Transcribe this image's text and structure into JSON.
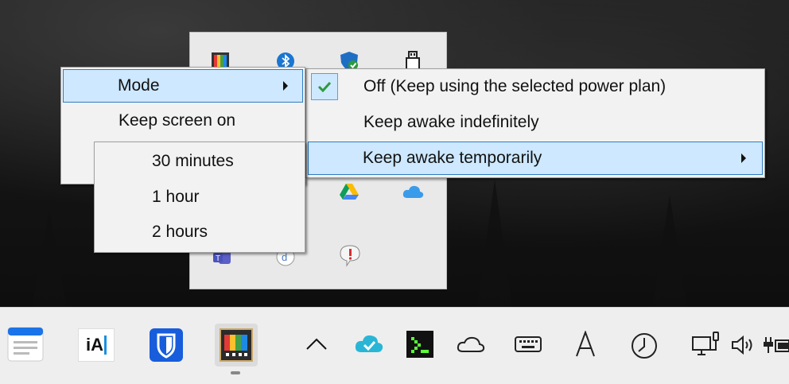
{
  "mode_menu": {
    "items": [
      {
        "label": "Mode"
      },
      {
        "label": "Keep screen on"
      }
    ]
  },
  "mode_submenu": {
    "items": [
      {
        "label": "Off (Keep using the selected power plan)",
        "checked": true
      },
      {
        "label": "Keep awake indefinitely"
      },
      {
        "label": "Keep awake temporarily"
      }
    ]
  },
  "temporary_submenu": {
    "items": [
      {
        "label": "30 minutes"
      },
      {
        "label": "1 hour"
      },
      {
        "label": "2 hours"
      }
    ]
  },
  "tray_flyout": {
    "icons": [
      "powertoys-awake-icon",
      "bluetooth-icon",
      "defender-icon",
      "usb-drive-icon",
      "google-drive-icon",
      "icloud-icon",
      "teams-icon",
      "app-d-icon",
      "feedback-icon"
    ]
  },
  "taskbar": {
    "text_icon_label": "iA",
    "icons": [
      "notepad-icon",
      "ia-writer-icon",
      "bitwarden-icon",
      "awake-app-icon",
      "show-hidden-icons-chevron",
      "cloud-check-icon",
      "terminal-green-icon",
      "onedrive-icon",
      "keyboard-icon",
      "font-a-icon",
      "clock-icon",
      "network-icon",
      "volume-icon",
      "power-icon"
    ]
  },
  "colors": {
    "highlight_bg": "#cde8ff",
    "highlight_border": "#2f7dc2",
    "check_green": "#2e9a3a",
    "bitwarden_blue": "#175ddc"
  }
}
